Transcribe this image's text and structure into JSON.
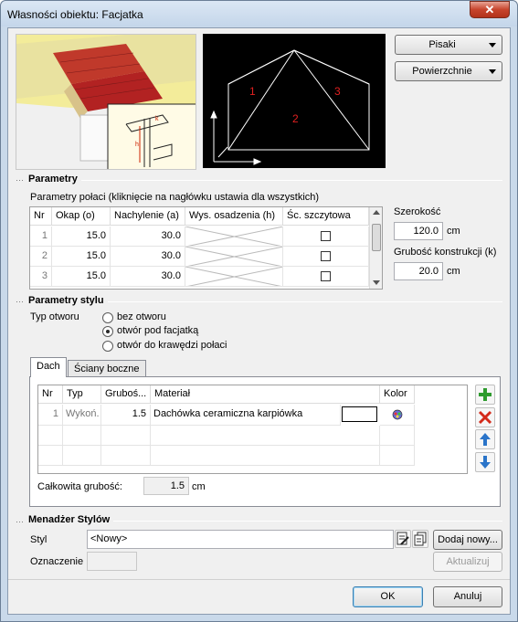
{
  "window": {
    "title": "Własności obiektu: Facjatka",
    "close_label": "✕"
  },
  "preview": {
    "labels": [
      "1",
      "2",
      "3"
    ],
    "dim_h": "h",
    "dim_k": "k"
  },
  "top_buttons": {
    "pisaki": "Pisaki",
    "powierzchnie": "Powierzchnie"
  },
  "params": {
    "header": "Parametry",
    "hint": "Parametry połaci (kliknięcie na nagłówku ustawia dla wszystkich)",
    "columns": [
      "Nr",
      "Okap (o)",
      "Nachylenie (a)",
      "Wys. osadzenia (h)",
      "Śc. szczytowa"
    ],
    "rows": [
      {
        "nr": "1",
        "okap": "15.0",
        "nachylenie": "30.0",
        "wys": "",
        "checked": false
      },
      {
        "nr": "2",
        "okap": "15.0",
        "nachylenie": "30.0",
        "wys": "",
        "checked": false
      },
      {
        "nr": "3",
        "okap": "15.0",
        "nachylenie": "30.0",
        "wys": "",
        "checked": false
      }
    ],
    "szerokosc_label": "Szerokość",
    "szerokosc_value": "120.0",
    "szerokosc_unit": "cm",
    "grubosc_label": "Grubość konstrukcji (k)",
    "grubosc_value": "20.0",
    "grubosc_unit": "cm"
  },
  "style": {
    "header": "Parametry stylu",
    "typ_label": "Typ otworu",
    "options": [
      "bez otworu",
      "otwór pod facjatką",
      "otwór do krawędzi połaci"
    ],
    "selected_index": 1,
    "tabs": [
      "Dach",
      "Ściany boczne"
    ],
    "active_tab": 0,
    "layer_columns": [
      "Nr",
      "Typ",
      "Gruboś...",
      "Materiał",
      "Kolor"
    ],
    "layers": [
      {
        "nr": "1",
        "typ": "Wykoń.",
        "grubosc": "1.5",
        "material": "Dachówka ceramiczna karpiówka"
      }
    ],
    "total_label": "Całkowita grubość:",
    "total_value": "1.5",
    "total_unit": "cm"
  },
  "manager": {
    "header": "Menadżer Stylów",
    "styl_label": "Styl",
    "styl_value": "<Nowy>",
    "oznaczenie_label": "Oznaczenie",
    "oznaczenie_value": "",
    "add_button": "Dodaj nowy...",
    "update_button": "Aktualizuj"
  },
  "footer": {
    "ok": "OK",
    "cancel": "Anuluj"
  },
  "colors": {
    "accent_red": "#cc2200",
    "add_green": "#2e9b2e",
    "arrow_blue": "#2a74c9",
    "delete_red": "#d42a1a"
  }
}
